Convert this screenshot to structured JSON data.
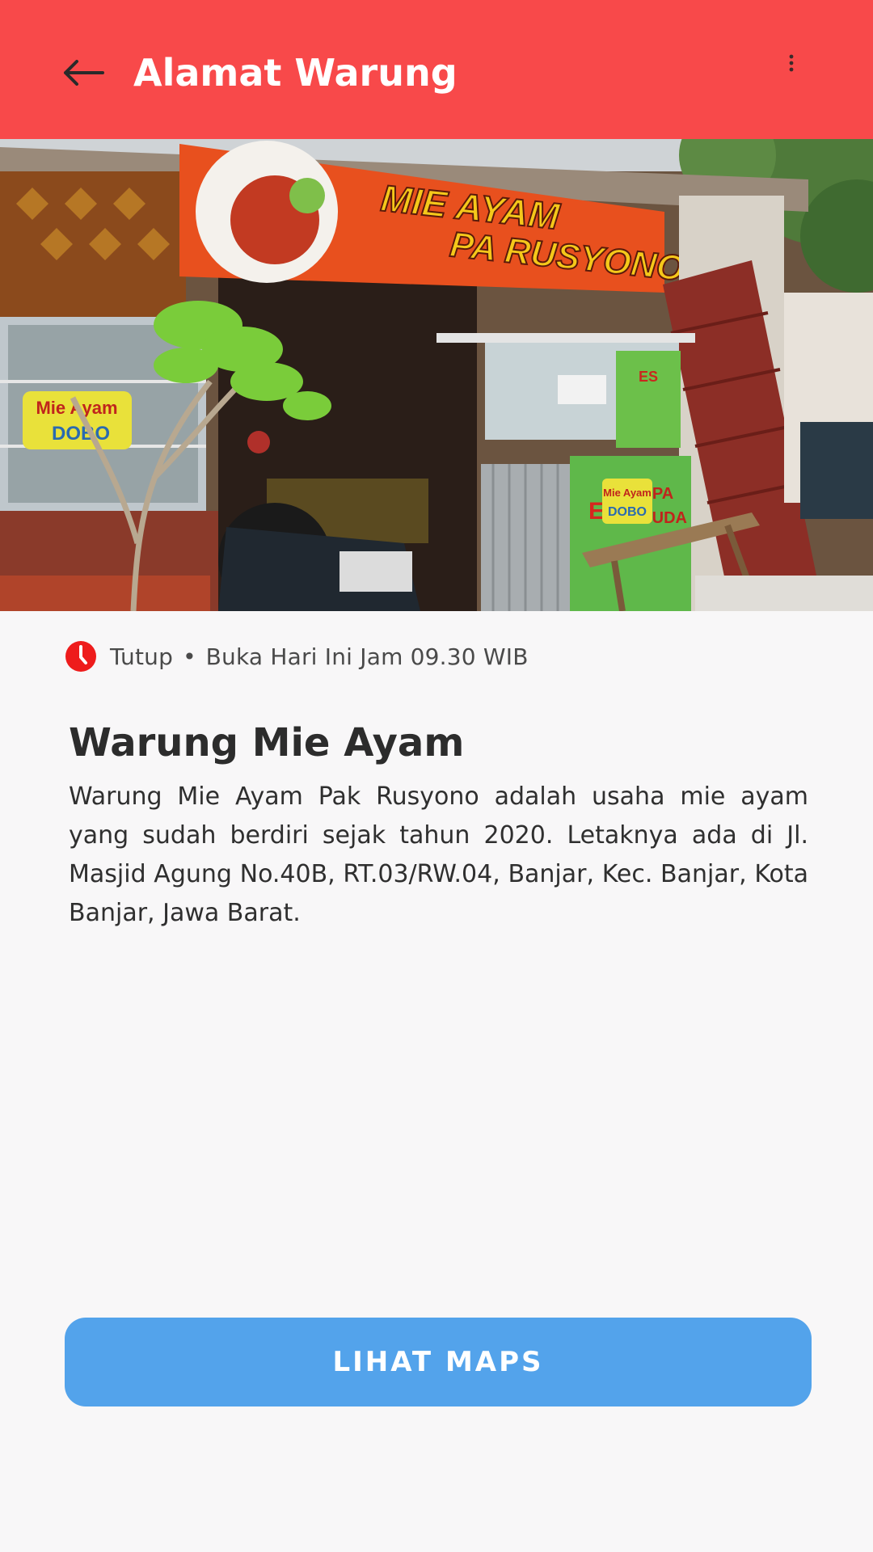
{
  "appbar": {
    "title": "Alamat Warung",
    "back_icon": "arrow-left-icon",
    "menu_icon": "more-vertical-icon",
    "color": "#f8494a"
  },
  "hero": {
    "signs": {
      "main_line1": "MIE AYAM",
      "main_line2": "PA RUSYONO",
      "window_line1": "Mie Ayam",
      "window_line2": "DOBO",
      "cart_es": "ES",
      "cart_brand_line1": "Mie Ayam",
      "cart_brand_line2": "DOBO",
      "cart_pa": "PA",
      "cart_muda": "MUDA",
      "cart_top": "ES"
    }
  },
  "status": {
    "icon": "clock-icon",
    "icon_color": "#ee1c1c",
    "state": "Tutup",
    "separator": "•",
    "schedule": "Buka Hari Ini Jam 09.30 WIB"
  },
  "shop": {
    "name": "Warung Mie Ayam",
    "description": "Warung Mie Ayam Pak Rusyono adalah usaha mie ayam yang sudah berdiri sejak tahun 2020. Letaknya ada di Jl. Masjid Agung No.40B, RT.03/RW.04, Banjar, Kec. Banjar, Kota Banjar, Jawa Barat."
  },
  "actions": {
    "maps_label": "LIHAT MAPS",
    "maps_color": "#53a3eb"
  }
}
